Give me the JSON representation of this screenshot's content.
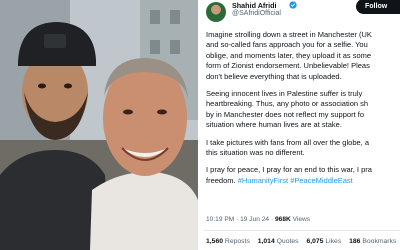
{
  "post": {
    "author": {
      "name": "Shahid Afridi",
      "handle": "@SAfridiOfficial"
    },
    "follow_label": "Follow",
    "body": {
      "p1": [
        "Imagine strolling down a street in Manchester (UK",
        "and so-called fans approach you for a selfie. You",
        "oblige, and moments later, they upload it as some",
        "form of Zionist endorsement. Unbelievable! Pleas",
        "don't believe everything that is uploaded."
      ],
      "p2": [
        "Seeing innocent lives in Palestine suffer is truly",
        "heartbreaking. Thus, any photo or association sh",
        "by in Manchester does not reflect my support fo",
        "situation where human lives are at stake."
      ],
      "p3": [
        "I take pictures with fans from all over the globe, a",
        "this situation was no different."
      ],
      "p4_line1": "I pray for peace, I pray for an end to this war, I pra",
      "p4_line2_text": "freedom.",
      "p4_hashtags": "#HumanityFirst #PeaceMiddleEast"
    },
    "meta": {
      "time": "10:19 PM",
      "sep1": "·",
      "date": "19 Jun 24",
      "sep2": "·",
      "views_count": "968K",
      "views_label": "Views"
    },
    "stats": {
      "replies_count": "1,560",
      "replies_label": "Reposts",
      "quotes_count": "1,014",
      "quotes_label": "Quotes",
      "likes_count": "6,075",
      "likes_label": "Likes",
      "bookmarks_count": "186",
      "bookmarks_label": "Bookmarks"
    }
  },
  "colors": {
    "link_blue": "#1d9bf0",
    "text_primary": "#0f1419",
    "text_secondary": "#536471",
    "verified_badge": "#1d9bf0"
  },
  "icons": {
    "verified": "verified-badge-icon"
  }
}
